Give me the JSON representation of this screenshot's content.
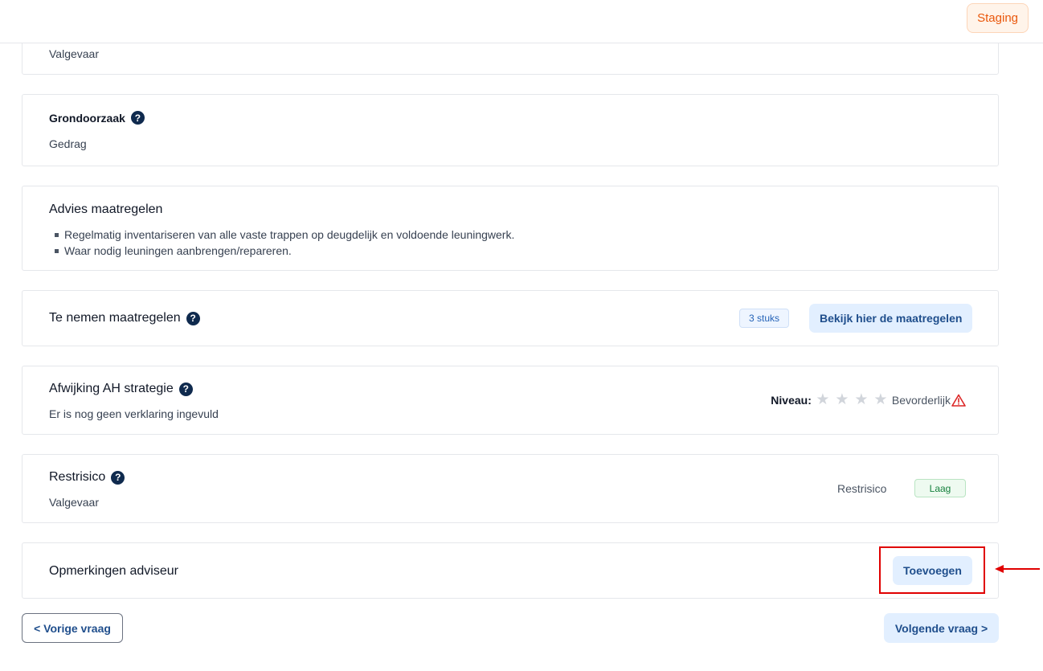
{
  "topbar": {
    "env_badge": "Staging"
  },
  "partial_card": {
    "value": "Valgevaar"
  },
  "grondoorzaak": {
    "title": "Grondoorzaak",
    "help": "?",
    "value": "Gedrag"
  },
  "advies": {
    "title": "Advies maatregelen",
    "items": [
      "Regelmatig inventariseren van alle vaste trappen op deugdelijk en voldoende leuningwerk.",
      "Waar nodig leuningen aanbrengen/repareren."
    ]
  },
  "te_nemen": {
    "title": "Te nemen maatregelen",
    "help": "?",
    "count_badge": "3 stuks",
    "button": "Bekijk hier de maatregelen"
  },
  "afwijking": {
    "title": "Afwijking AH strategie",
    "help": "?",
    "value": "Er is nog geen verklaring ingevuld",
    "niveau_label": "Niveau:",
    "stars_filled": 0,
    "stars_total": 4,
    "status": "Bevorderlijk",
    "status_icon": "warning-triangle-icon",
    "star_icon": "★"
  },
  "restrisico": {
    "title": "Restrisico",
    "help": "?",
    "value": "Valgevaar",
    "label": "Restrisico",
    "badge": "Laag"
  },
  "opmerkingen": {
    "title": "Opmerkingen adviseur",
    "button": "Toevoegen"
  },
  "navigation": {
    "prev": "< Vorige vraag",
    "next": "Volgende vraag >"
  },
  "colors": {
    "accent": "#1f4e8c",
    "highlight": "#e00000",
    "staging": "#ea580c"
  }
}
